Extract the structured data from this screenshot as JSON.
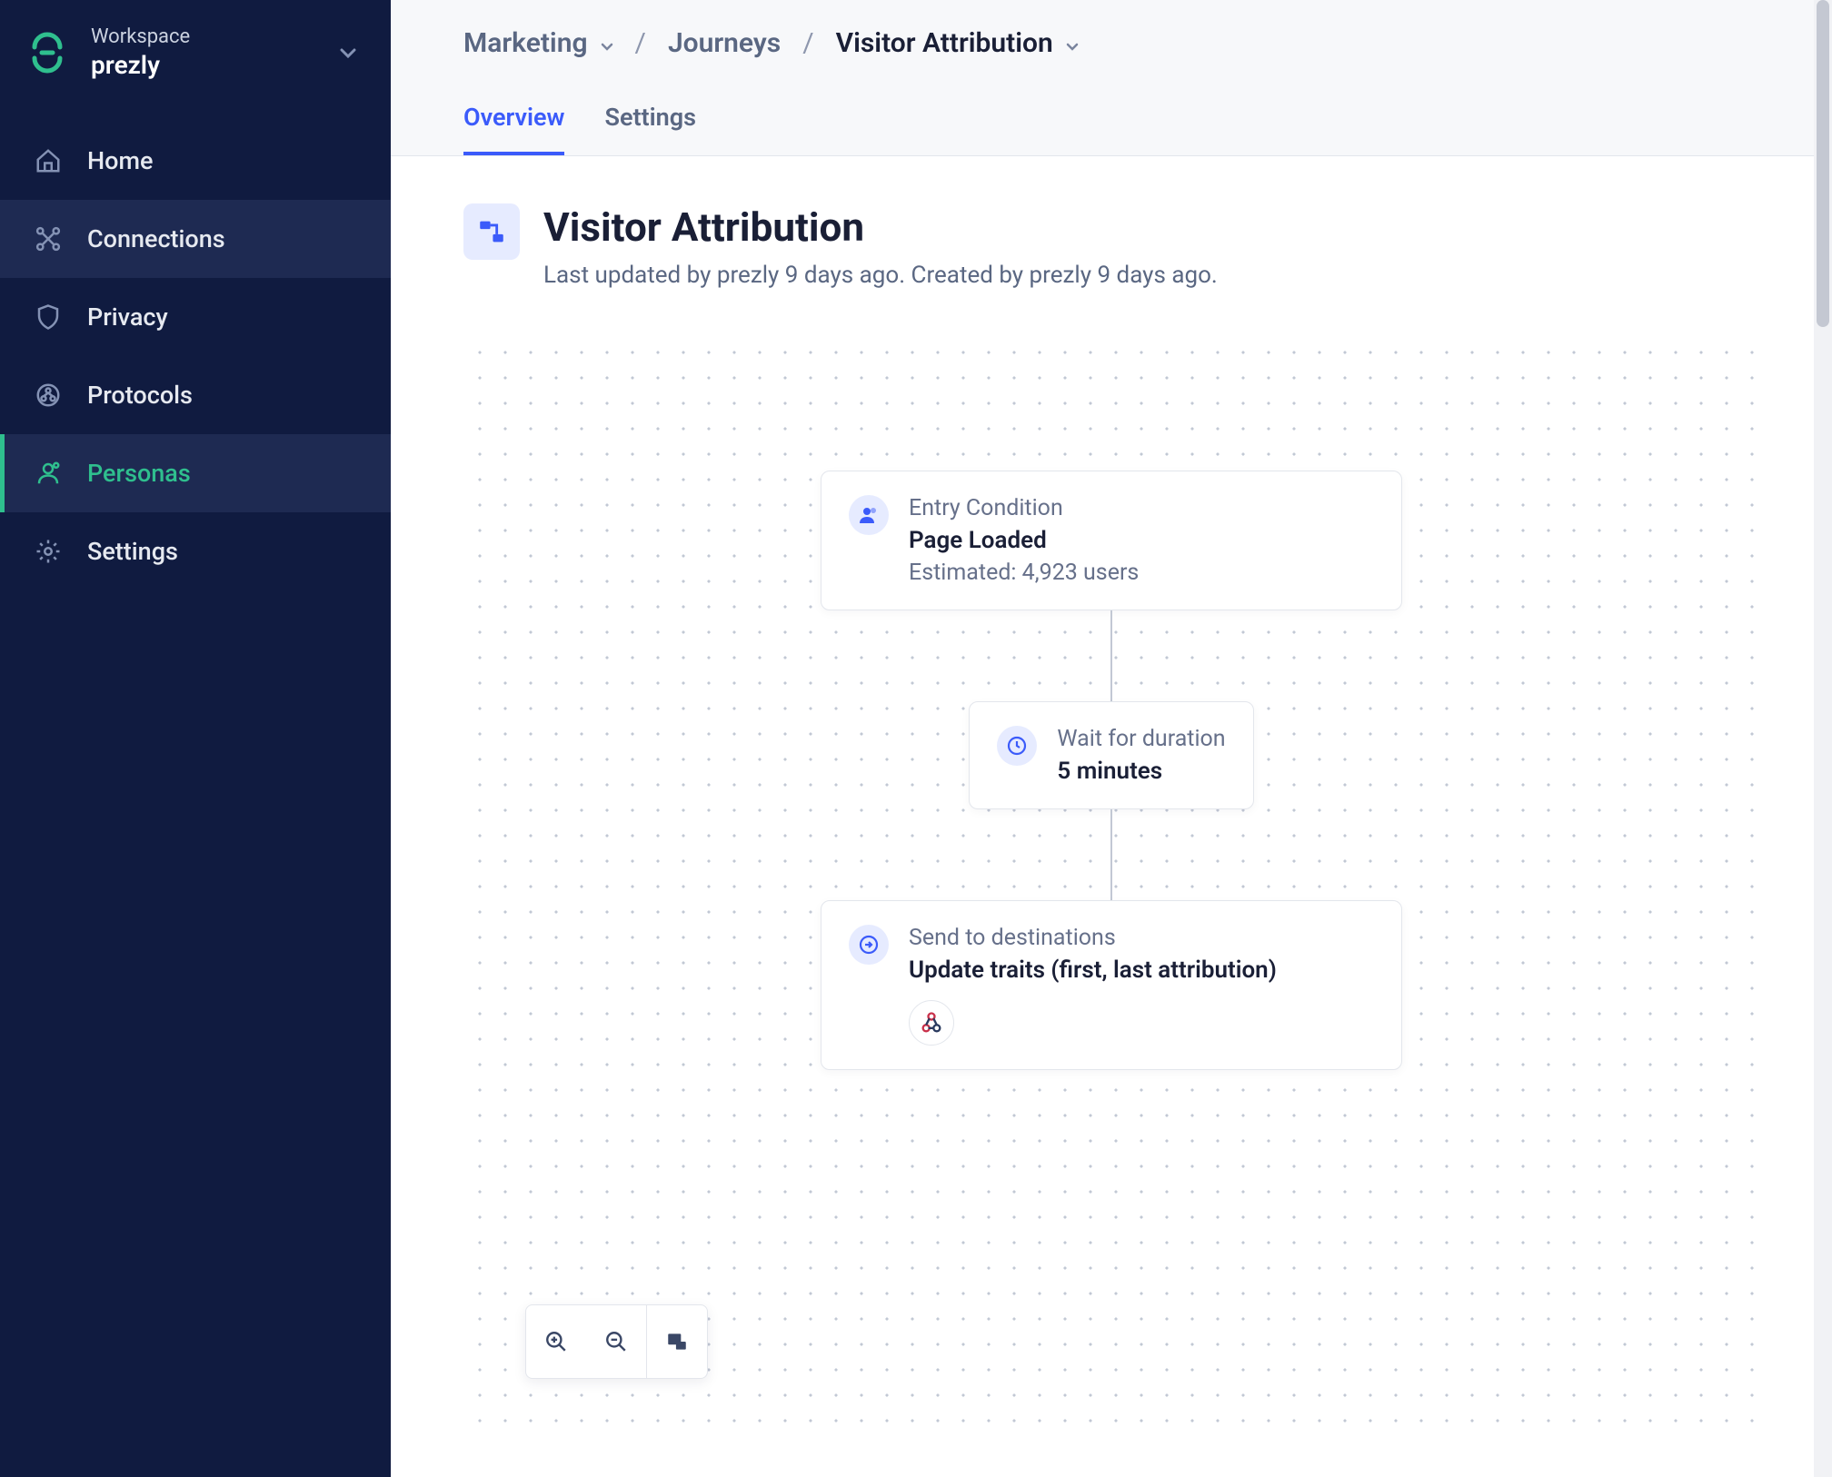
{
  "workspace": {
    "label": "Workspace",
    "name": "prezly"
  },
  "sidebar": {
    "items": [
      {
        "label": "Home"
      },
      {
        "label": "Connections"
      },
      {
        "label": "Privacy"
      },
      {
        "label": "Protocols"
      },
      {
        "label": "Personas"
      },
      {
        "label": "Settings"
      }
    ]
  },
  "breadcrumb": {
    "project": "Marketing",
    "section": "Journeys",
    "current": "Visitor Attribution"
  },
  "tabs": [
    {
      "label": "Overview"
    },
    {
      "label": "Settings"
    }
  ],
  "page": {
    "title": "Visitor Attribution",
    "subtitle": "Last updated by prezly 9 days ago. Created by prezly 9 days ago."
  },
  "flow": {
    "entry": {
      "label": "Entry Condition",
      "title": "Page Loaded",
      "estimate": "Estimated: 4,923 users"
    },
    "wait": {
      "label": "Wait for duration",
      "title": "5 minutes"
    },
    "dest": {
      "label": "Send to destinations",
      "title": "Update traits (first, last attribution)"
    }
  }
}
